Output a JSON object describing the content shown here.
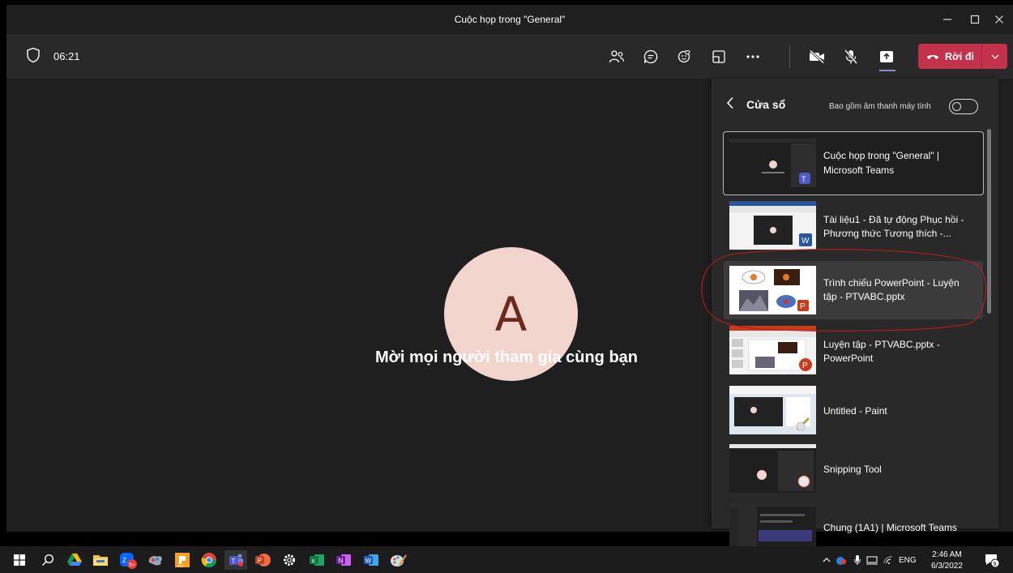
{
  "window": {
    "title": "Cuộc họp trong \"General\"",
    "controls": [
      "minimize",
      "maximize",
      "close"
    ]
  },
  "toolbar": {
    "timer": "06:21",
    "leave_label": "Rời đi",
    "icons": [
      "participants-icon",
      "chat-icon",
      "reactions-icon",
      "rooms-icon",
      "more-icon",
      "camera-off-icon",
      "mic-off-icon",
      "share-icon"
    ]
  },
  "stage": {
    "avatar_initial": "A",
    "avatar_color": "#f1d5cc",
    "invite_text": "Mời mọi người tham gia cùng bạn"
  },
  "share_panel": {
    "title": "Cửa sổ",
    "audio_label": "Bao gồm âm thanh máy tính",
    "audio_toggle": "off",
    "windows": [
      {
        "label": "Cuộc họp trong \"General\" | Microsoft Teams",
        "app": "teams",
        "state": "selected"
      },
      {
        "label": "Tài liệu1 - Đã tự động Phục hồi - Phương thức Tương thích -...",
        "app": "word",
        "state": "normal"
      },
      {
        "label": "Trình chiếu PowerPoint - Luyện tập - PTVABC.pptx",
        "app": "powerpoint",
        "state": "hover"
      },
      {
        "label": "Luyện tập - PTVABC.pptx - PowerPoint",
        "app": "powerpoint",
        "state": "normal"
      },
      {
        "label": "Untitled - Paint",
        "app": "paint",
        "state": "normal"
      },
      {
        "label": "Snipping Tool",
        "app": "snipping",
        "state": "normal"
      },
      {
        "label": "Chung (1A1) | Microsoft Teams",
        "app": "teams",
        "state": "normal"
      }
    ]
  },
  "taskbar": {
    "apps": [
      "start-icon",
      "search-icon",
      "google-drive-icon",
      "file-explorer-icon",
      "zalo-icon",
      "paint-3d-icon",
      "office-icon",
      "chrome-icon",
      "teams-icon",
      "powerpoint-icon",
      "settings-icon",
      "excel-icon",
      "onenote-icon",
      "word-icon",
      "paint-icon"
    ],
    "zalo_badge": "5+",
    "tray_language": "ENG",
    "clock_time": "2:46 AM",
    "clock_date": "6/3/2022",
    "notification_count": "9"
  },
  "colors": {
    "leave_button": "#c4314b",
    "panel_bg": "#292929",
    "stage_bg": "#1f1f1f",
    "annotation_red": "#c0181d"
  }
}
